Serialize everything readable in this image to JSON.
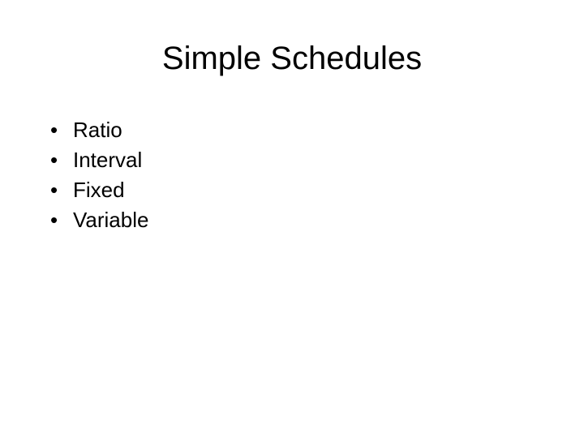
{
  "slide": {
    "title": "Simple Schedules",
    "bullets": [
      {
        "marker": "•",
        "text": "Ratio"
      },
      {
        "marker": "•",
        "text": "Interval"
      },
      {
        "marker": "•",
        "text": "Fixed"
      },
      {
        "marker": "•",
        "text": "Variable"
      }
    ]
  }
}
